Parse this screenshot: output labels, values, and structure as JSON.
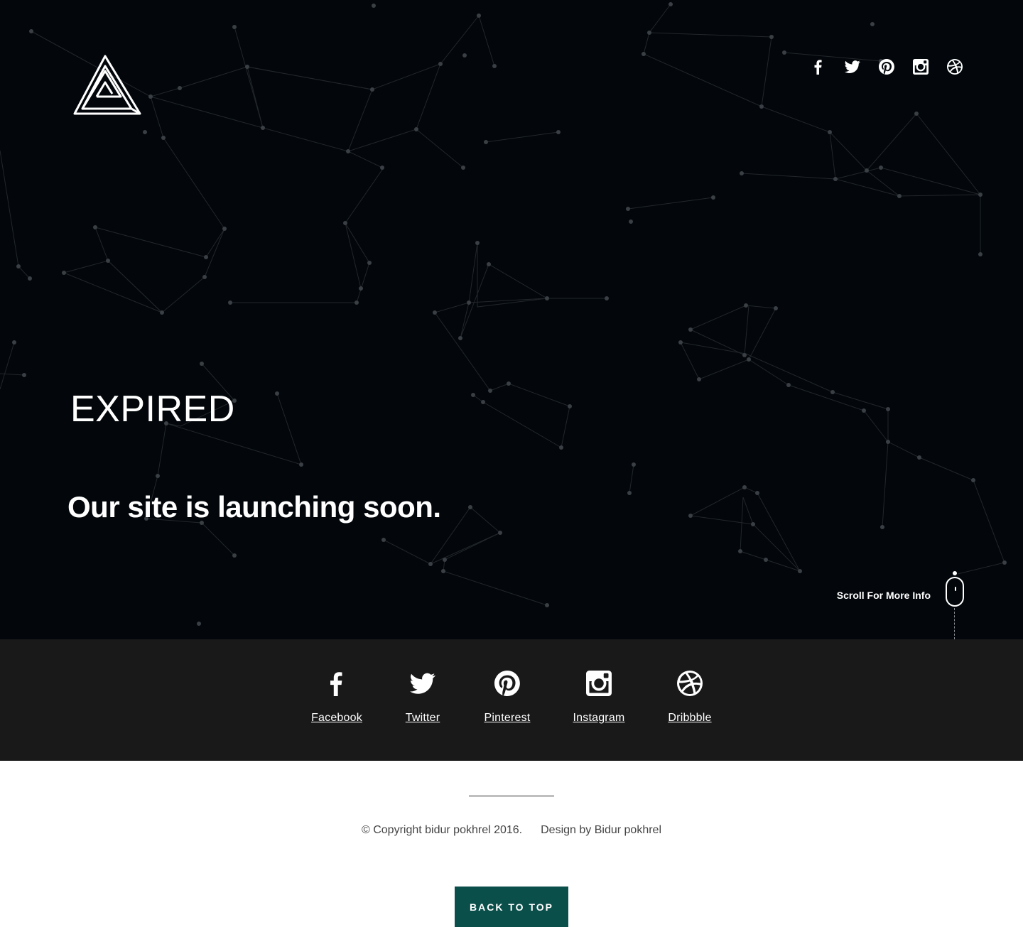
{
  "hero": {
    "status_text": "EXPIRED",
    "tagline": "Our site is launching soon.",
    "scroll_hint": "Scroll For More Info",
    "background_color": "#03070b"
  },
  "header": {
    "logo_icon": "impossible-triangle-logo",
    "social_icons": [
      "facebook-icon",
      "twitter-icon",
      "pinterest-icon",
      "instagram-icon",
      "dribbble-icon"
    ]
  },
  "social_band": {
    "background_color": "#191919",
    "items": [
      {
        "label": "Facebook",
        "icon": "facebook-icon"
      },
      {
        "label": "Twitter",
        "icon": "twitter-icon"
      },
      {
        "label": "Pinterest",
        "icon": "pinterest-icon"
      },
      {
        "label": "Instagram",
        "icon": "instagram-icon"
      },
      {
        "label": "Dribbble",
        "icon": "dribbble-icon"
      }
    ]
  },
  "footer": {
    "copyright": "© Copyright bidur pokhrel 2016.",
    "credit": "Design by Bidur pokhrel",
    "back_to_top_label": "BACK TO TOP",
    "accent_color": "#0b4f4b"
  }
}
